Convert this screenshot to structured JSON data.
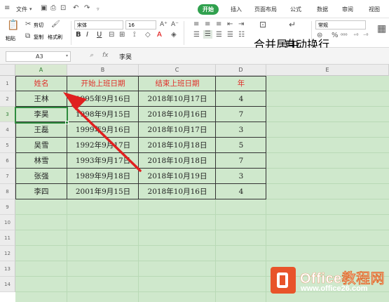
{
  "menubar": {
    "file_menu": "文件",
    "tabs": [
      {
        "label": "开始",
        "active": true
      },
      {
        "label": "插入"
      },
      {
        "label": "页面布局"
      },
      {
        "label": "公式"
      },
      {
        "label": "数据"
      },
      {
        "label": "审阅"
      },
      {
        "label": "视图"
      }
    ]
  },
  "toolbar": {
    "paste_label": "粘贴",
    "cut_label": "剪切",
    "copy_label": "复制",
    "format_painter_label": "格式刷",
    "font_name": "宋体",
    "font_size": "16",
    "merge_center_label": "合并居中",
    "wrap_text_label": "自动换行",
    "number_format": "常规",
    "bold": "B",
    "italic": "I",
    "underline": "U"
  },
  "formula_bar": {
    "name_box": "A3",
    "fx_label": "fx",
    "value": "李昊"
  },
  "grid": {
    "columns": [
      "A",
      "B",
      "C",
      "D",
      "E"
    ],
    "row_numbers": [
      "1",
      "2",
      "3",
      "4",
      "5",
      "6",
      "7",
      "8",
      "9",
      "10",
      "11",
      "12",
      "13",
      "14"
    ],
    "header": [
      "姓名",
      "开始上班日期",
      "结束上班日期",
      "年"
    ],
    "rows": [
      [
        "王林",
        "1995年9月16日",
        "2018年10月17日",
        "4"
      ],
      [
        "李昊",
        "1998年9月15日",
        "2018年10月16日",
        "7"
      ],
      [
        "王磊",
        "1999年9月16日",
        "2018年10月17日",
        "3"
      ],
      [
        "吴雪",
        "1992年9月17日",
        "2018年10月18日",
        "5"
      ],
      [
        "林雪",
        "1993年9月17日",
        "2018年10月18日",
        "7"
      ],
      [
        "张强",
        "1989年9月18日",
        "2018年10月19日",
        "3"
      ],
      [
        "李四",
        "2001年9月15日",
        "2018年10月16日",
        "4"
      ]
    ],
    "active_cell": "A3"
  },
  "logo": {
    "brand": "Office教程网",
    "url": "www.office26.com"
  },
  "colors": {
    "accent_green": "#30a14e",
    "sheet_bg": "#cfe8cc",
    "header_red": "#e0302a",
    "arrow_red": "#e02020",
    "logo_orange": "#e8542a"
  }
}
